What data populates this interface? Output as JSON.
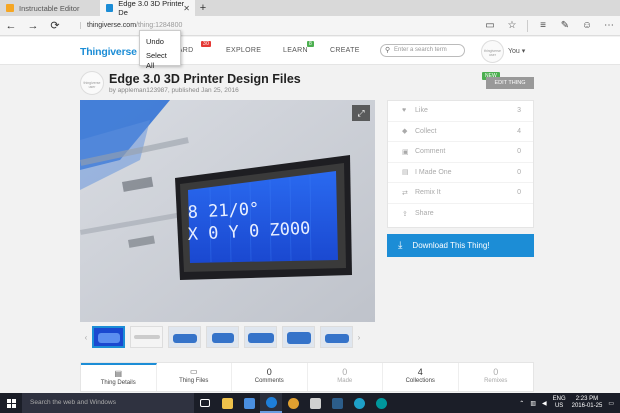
{
  "browser": {
    "tabs": [
      {
        "title": "Instructable Editor",
        "active": false,
        "favicon_color": "#f5a623"
      },
      {
        "title": "Edge 3.0 3D Printer De",
        "active": true,
        "favicon_color": "#1c8dd6"
      }
    ],
    "new_tab_glyph": "+",
    "url_domain": "thingiverse.com",
    "url_path": "/thing:1284800",
    "nav": {
      "back": "←",
      "forward": "→",
      "refresh": "⟳"
    },
    "icons": {
      "reading_view": "▭",
      "favorite": "☆",
      "hub": "≡",
      "note": "✎",
      "share": "☺",
      "more": "⋯"
    }
  },
  "context_menu": {
    "items": [
      "Undo",
      "Select All"
    ]
  },
  "site": {
    "logo": "Thingiverse",
    "nav": [
      "DASHBOARD",
      "EXPLORE",
      "LEARN",
      "CREATE"
    ],
    "nav_visible": [
      "OARD",
      "EXPLORE",
      "LEARN",
      "CREATE"
    ],
    "dashboard_badge": "30",
    "learn_badge": "8",
    "search_placeholder": "Enter a search term",
    "user_avatar_text": "thingiverse user",
    "user_label": "You ▾"
  },
  "thing": {
    "avatar_text": "thingiverse user",
    "title": "Edge 3.0 3D Printer Design Files",
    "byline": "by appleman123987, published Jan 25, 2016",
    "new_tag": "NEW",
    "edit_label": "EDIT THING",
    "lcd_line1": "8 21/0°",
    "lcd_line2": "X 0 Y 0   Z000",
    "thumb_nav_left": "‹",
    "thumb_nav_right": "›",
    "thumbnail_count": 7
  },
  "stats": [
    {
      "icon": "heart",
      "glyph": "♥",
      "label": "Like",
      "count": "3"
    },
    {
      "icon": "collect",
      "glyph": "◆",
      "label": "Collect",
      "count": "4"
    },
    {
      "icon": "comment",
      "glyph": "▣",
      "label": "Comment",
      "count": "0"
    },
    {
      "icon": "made-one",
      "glyph": "▤",
      "label": "I Made One",
      "count": "0"
    },
    {
      "icon": "remix",
      "glyph": "⇄",
      "label": "Remix It",
      "count": "0"
    },
    {
      "icon": "share",
      "glyph": "⇪",
      "label": "Share",
      "count": ""
    }
  ],
  "download_label": "Download This Thing!",
  "bottom_tabs": [
    {
      "icon": "▤",
      "num": "",
      "label": "Thing Details",
      "active": true,
      "dim": false
    },
    {
      "icon": "▭",
      "num": "",
      "label": "Thing Files",
      "active": false,
      "dim": false
    },
    {
      "icon": "",
      "num": "0",
      "label": "Comments",
      "active": false,
      "dim": false
    },
    {
      "icon": "",
      "num": "0",
      "label": "Made",
      "active": false,
      "dim": true
    },
    {
      "icon": "",
      "num": "4",
      "label": "Collections",
      "active": false,
      "dim": false
    },
    {
      "icon": "",
      "num": "0",
      "label": "Remixes",
      "active": false,
      "dim": true
    }
  ],
  "taskbar": {
    "search_placeholder": "Search the web and Windows",
    "apps": [
      {
        "name": "task-view",
        "color": "#ffffff"
      },
      {
        "name": "file-explorer",
        "color": "#f0c24b"
      },
      {
        "name": "store",
        "color": "#4a8fe0"
      },
      {
        "name": "edge",
        "color": "#1e7ed8"
      },
      {
        "name": "chrome",
        "color": "#e0a030"
      },
      {
        "name": "app-generic",
        "color": "#d0d0d0"
      },
      {
        "name": "lightroom",
        "color": "#2c5d8a"
      },
      {
        "name": "cortana-c",
        "color": "#1ea0c8"
      },
      {
        "name": "arduino",
        "color": "#00979c"
      }
    ],
    "lang_line1": "ENG",
    "lang_line2": "US",
    "time": "2:23 PM",
    "date": "2016-01-25"
  },
  "colors": {
    "accent": "#1c8dd6",
    "dashboard_badge": "#e53935",
    "learn_badge": "#4caf50"
  }
}
